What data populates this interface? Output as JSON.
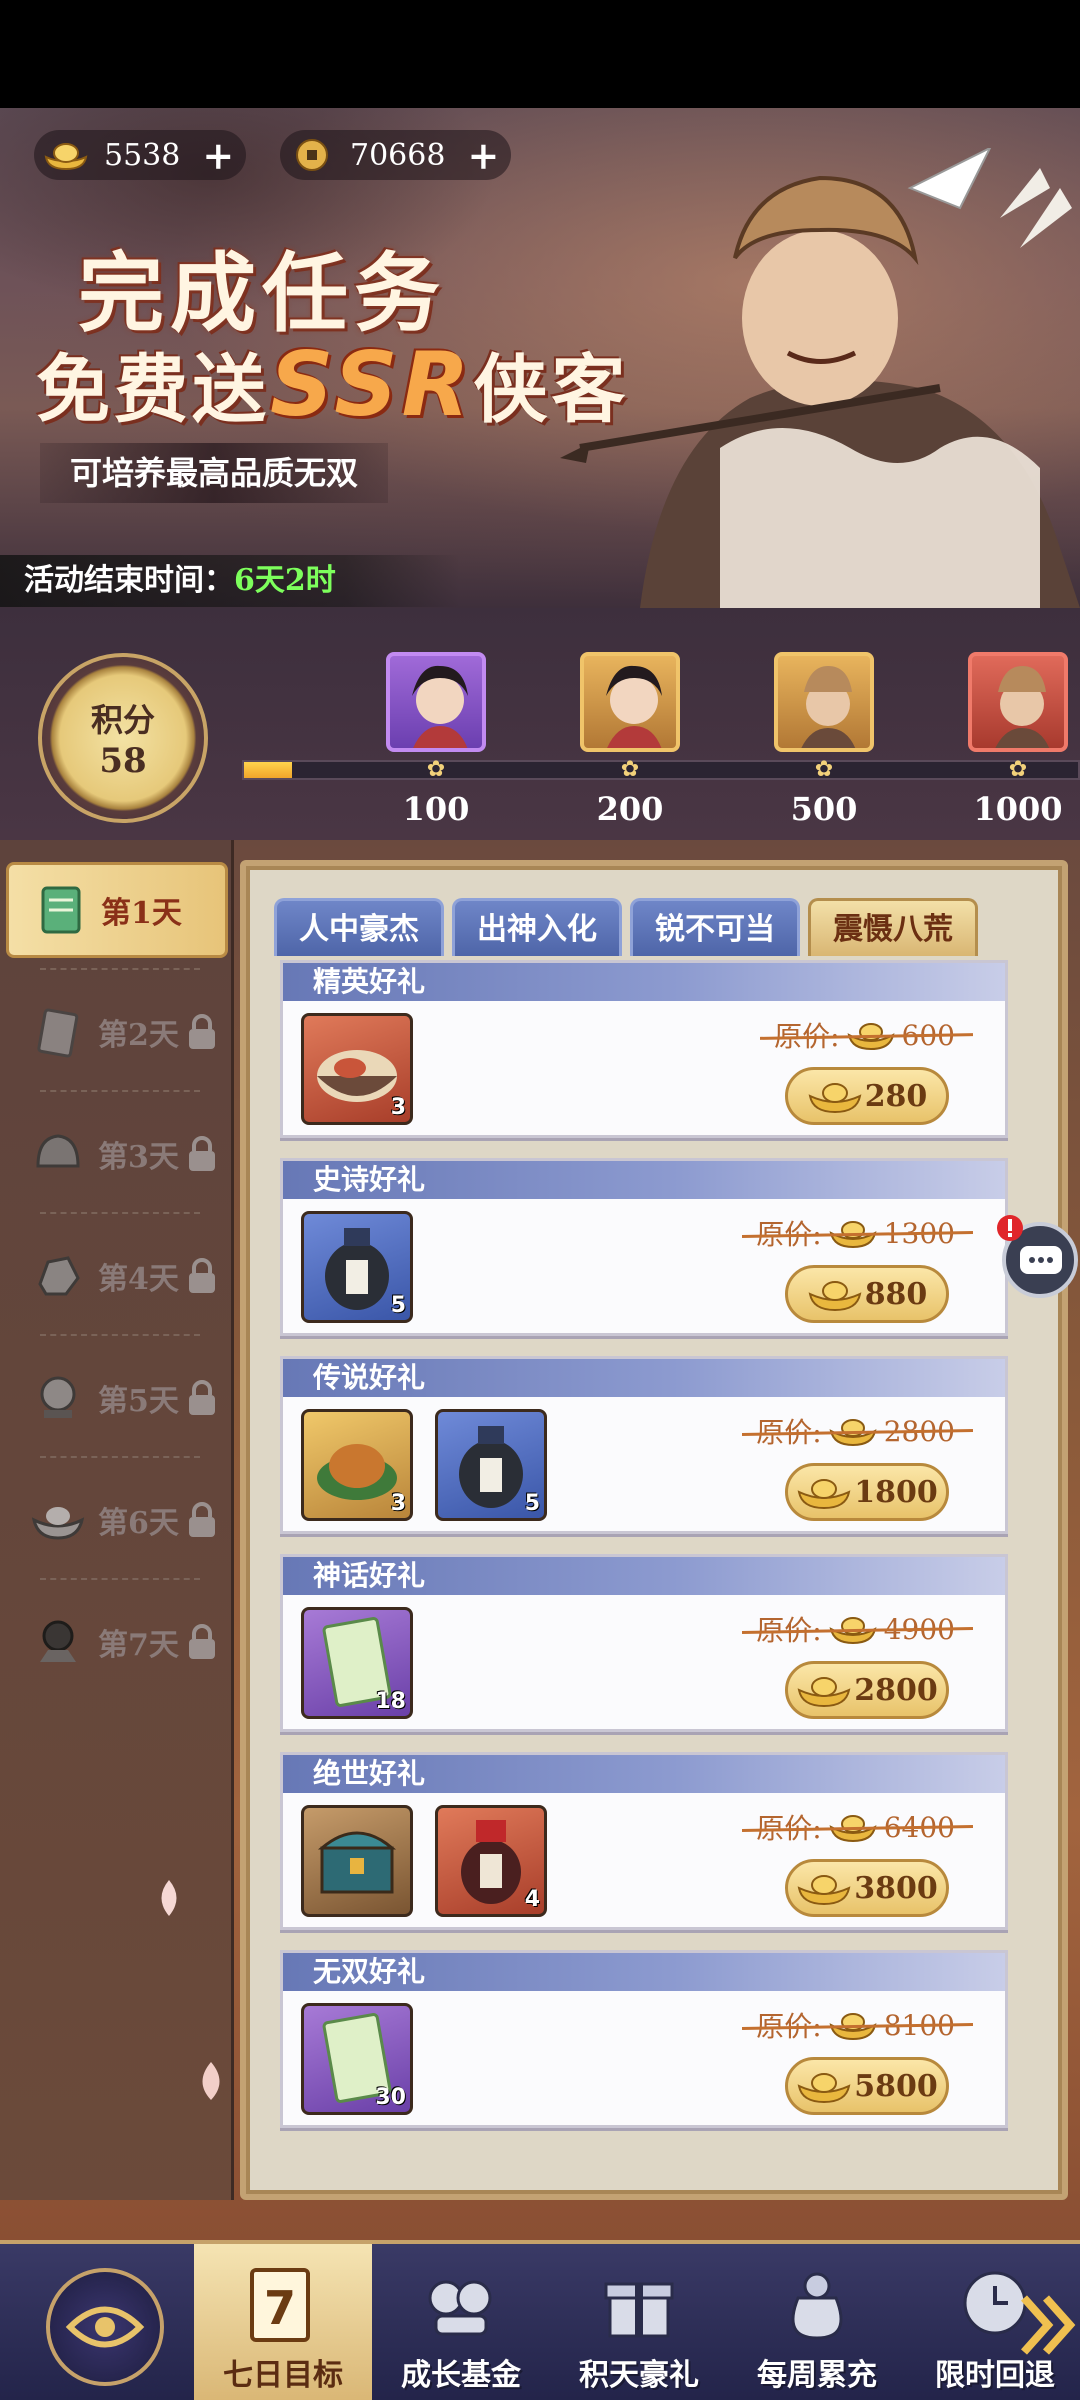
{
  "currency": [
    {
      "icon": "gold-ingot-icon",
      "amount": "5538",
      "plus": "+"
    },
    {
      "icon": "copper-coin-icon",
      "amount": "70668",
      "plus": "+"
    }
  ],
  "banner": {
    "title_line1": "完成任务",
    "title_line2_prefix": "免费送",
    "title_line2_ssr": "SSR",
    "title_line2_suffix": "侠客",
    "subtitle": "可培养最高品质无双",
    "end_time_label": "活动结束时间：",
    "end_time_value": "6天2时"
  },
  "score": {
    "label": "积分",
    "value": "58",
    "progress_fraction": 0.058
  },
  "milestones": [
    {
      "value": "100",
      "frame": "purple"
    },
    {
      "value": "200",
      "frame": "gold"
    },
    {
      "value": "500",
      "frame": "gold"
    },
    {
      "value": "1000",
      "frame": "red"
    }
  ],
  "days": [
    {
      "label": "第1天",
      "locked": false,
      "active": true
    },
    {
      "label": "第2天",
      "locked": true,
      "active": false
    },
    {
      "label": "第3天",
      "locked": true,
      "active": false
    },
    {
      "label": "第4天",
      "locked": true,
      "active": false
    },
    {
      "label": "第5天",
      "locked": true,
      "active": false
    },
    {
      "label": "第6天",
      "locked": true,
      "active": false
    },
    {
      "label": "第7天",
      "locked": true,
      "active": false
    }
  ],
  "tabs": [
    {
      "label": "人中豪杰",
      "active": false
    },
    {
      "label": "出神入化",
      "active": false
    },
    {
      "label": "锐不可当",
      "active": false
    },
    {
      "label": "震慑八荒",
      "active": true
    }
  ],
  "orig_price_label": "原价:",
  "gifts": [
    {
      "title": "精英好礼",
      "orig_price": "600",
      "price": "280",
      "items": [
        {
          "icon": "noodle-bowl-icon",
          "qty": "3",
          "frame": "red"
        }
      ]
    },
    {
      "title": "史诗好礼",
      "orig_price": "1300",
      "price": "880",
      "items": [
        {
          "icon": "wine-jar-icon",
          "qty": "5",
          "frame": "blue"
        }
      ]
    },
    {
      "title": "传说好礼",
      "orig_price": "2800",
      "price": "1800",
      "items": [
        {
          "icon": "roast-chicken-icon",
          "qty": "3",
          "frame": "gold"
        },
        {
          "icon": "wine-jar-icon",
          "qty": "5",
          "frame": "blue"
        }
      ]
    },
    {
      "title": "神话好礼",
      "orig_price": "4900",
      "price": "2800",
      "items": [
        {
          "icon": "skill-book-icon",
          "qty": "18",
          "frame": "purple"
        }
      ]
    },
    {
      "title": "绝世好礼",
      "orig_price": "6400",
      "price": "3800",
      "items": [
        {
          "icon": "treasure-chest-icon",
          "qty": "",
          "frame": "brown"
        },
        {
          "icon": "red-wine-jar-icon",
          "qty": "4",
          "frame": "red"
        }
      ]
    },
    {
      "title": "无双好礼",
      "orig_price": "8100",
      "price": "5800",
      "items": [
        {
          "icon": "skill-book-icon",
          "qty": "30",
          "frame": "purple"
        }
      ]
    }
  ],
  "bottom_nav": [
    {
      "label": "七日目标",
      "icon": "seven-day-calendar-icon",
      "active": true
    },
    {
      "label": "成长基金",
      "icon": "coin-stack-icon",
      "active": false
    },
    {
      "label": "积天豪礼",
      "icon": "gift-box-icon",
      "active": false
    },
    {
      "label": "每周累充",
      "icon": "money-bag-icon",
      "active": false
    },
    {
      "label": "限时回退",
      "icon": "clock-rewind-icon",
      "active": false
    }
  ],
  "colors": {
    "accent_gold": "#e8c36a",
    "tab_blue": "#4e65a8",
    "time_green": "#7dff5c",
    "price_brown": "#b4652f"
  }
}
